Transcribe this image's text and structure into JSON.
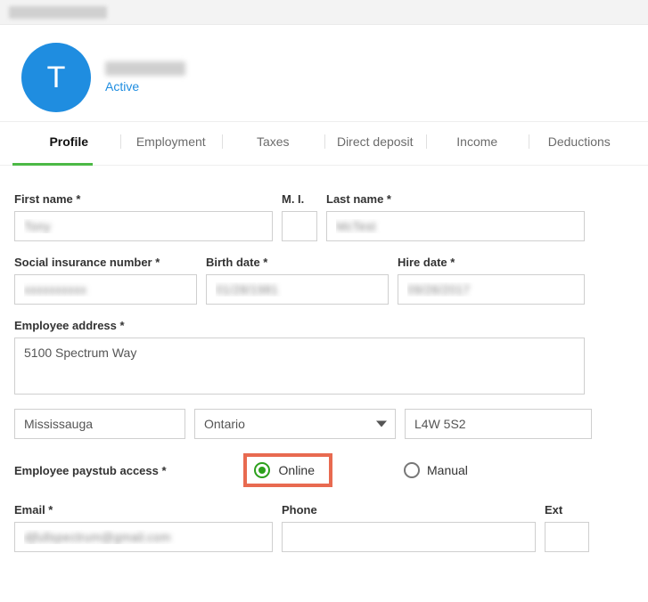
{
  "topbar": {
    "blurred": true
  },
  "employee": {
    "initial": "T",
    "status": "Active"
  },
  "tabs": [
    {
      "label": "Profile",
      "active": true
    },
    {
      "label": "Employment",
      "active": false
    },
    {
      "label": "Taxes",
      "active": false
    },
    {
      "label": "Direct deposit",
      "active": false
    },
    {
      "label": "Income",
      "active": false
    },
    {
      "label": "Deductions",
      "active": false
    }
  ],
  "form": {
    "first_name": {
      "label": "First name *",
      "value": ""
    },
    "mi": {
      "label": "M. I.",
      "value": ""
    },
    "last_name": {
      "label": "Last name *",
      "value": ""
    },
    "sin": {
      "label": "Social insurance number *",
      "value": ""
    },
    "birth_date": {
      "label": "Birth date *",
      "value": ""
    },
    "hire_date": {
      "label": "Hire date *",
      "value": ""
    },
    "address": {
      "label": "Employee address *",
      "value": "5100 Spectrum Way"
    },
    "city": {
      "value": "Mississauga"
    },
    "province": {
      "value": "Ontario"
    },
    "postal": {
      "value": "L4W 5S2"
    },
    "paystub": {
      "label": "Employee paystub access *",
      "options": {
        "online": "Online",
        "manual": "Manual"
      },
      "selected": "online"
    },
    "email": {
      "label": "Email *",
      "value": ""
    },
    "phone": {
      "label": "Phone",
      "value": ""
    },
    "ext": {
      "label": "Ext",
      "value": ""
    }
  }
}
